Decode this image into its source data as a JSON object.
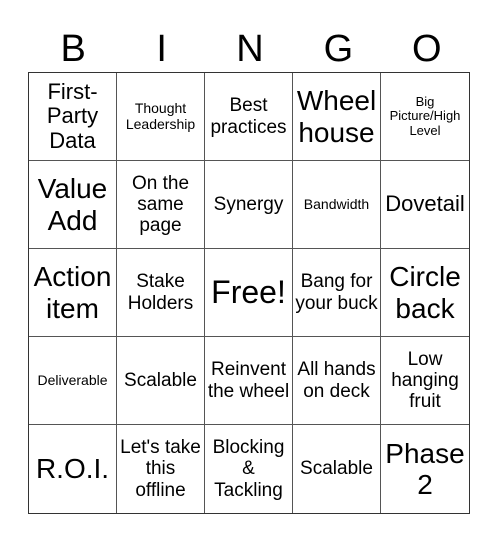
{
  "header": {
    "letters": [
      "B",
      "I",
      "N",
      "G",
      "O"
    ]
  },
  "cells": [
    {
      "text": "First-Party Data",
      "size": "s-m"
    },
    {
      "text": "Thought Leadership",
      "size": "s-s"
    },
    {
      "text": "Best practices",
      "size": "s-n"
    },
    {
      "text": "Wheel house",
      "size": "s-l"
    },
    {
      "text": "Big Picture/High Level",
      "size": "s-xs"
    },
    {
      "text": "Value Add",
      "size": "s-l"
    },
    {
      "text": "On the same page",
      "size": "s-n"
    },
    {
      "text": "Synergy",
      "size": "s-n"
    },
    {
      "text": "Bandwidth",
      "size": "s-s"
    },
    {
      "text": "Dovetail",
      "size": "s-m"
    },
    {
      "text": "Action item",
      "size": "s-l"
    },
    {
      "text": "Stake Holders",
      "size": "s-n"
    },
    {
      "text": "Free!",
      "size": "s-xl"
    },
    {
      "text": "Bang for your buck",
      "size": "s-n"
    },
    {
      "text": "Circle back",
      "size": "s-l"
    },
    {
      "text": "Deliverable",
      "size": "s-s"
    },
    {
      "text": "Scalable",
      "size": "s-n"
    },
    {
      "text": "Reinvent the wheel",
      "size": "s-n"
    },
    {
      "text": "All hands on deck",
      "size": "s-n"
    },
    {
      "text": "Low hanging fruit",
      "size": "s-n"
    },
    {
      "text": "R.O.I.",
      "size": "s-l"
    },
    {
      "text": "Let's take this offline",
      "size": "s-n"
    },
    {
      "text": "Blocking & Tackling",
      "size": "s-n"
    },
    {
      "text": "Scalable",
      "size": "s-n"
    },
    {
      "text": "Phase 2",
      "size": "s-l"
    }
  ]
}
